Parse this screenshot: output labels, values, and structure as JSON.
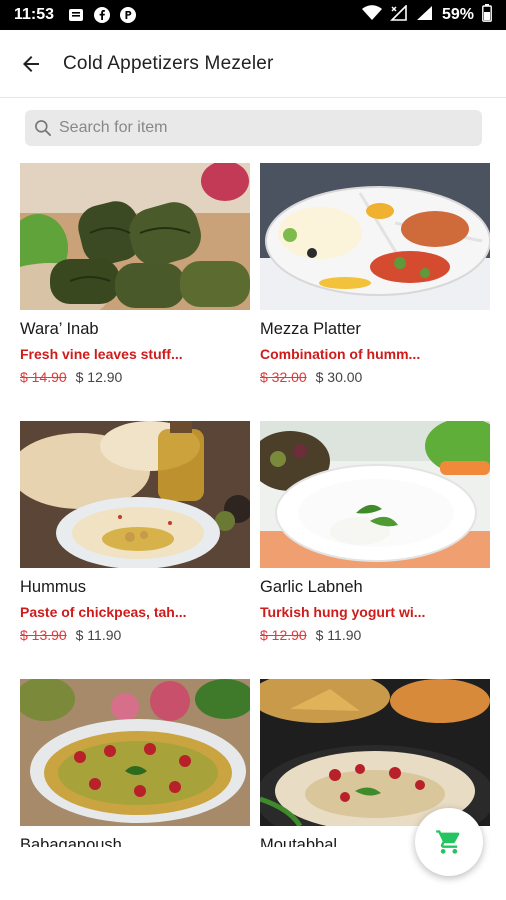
{
  "status_bar": {
    "time": "11:53",
    "battery": "59%"
  },
  "header": {
    "title": "Cold Appetizers Mezeler"
  },
  "search": {
    "placeholder": "Search for item"
  },
  "items": [
    {
      "name": "Wara’ Inab",
      "description": "Fresh vine leaves stuff...",
      "old_price": "$ 14.90",
      "price": "$ 12.90"
    },
    {
      "name": "Mezza Platter",
      "description": "Combination of humm...",
      "old_price": "$ 32.00",
      "price": "$ 30.00"
    },
    {
      "name": "Hummus",
      "description": "Paste of chickpeas, tah...",
      "old_price": "$ 13.90",
      "price": "$ 11.90"
    },
    {
      "name": "Garlic Labneh",
      "description": "Turkish hung yogurt wi...",
      "old_price": "$ 12.90",
      "price": "$ 11.90"
    },
    {
      "name": "Babaganoush",
      "description": "",
      "old_price": "",
      "price": ""
    },
    {
      "name": "Moutabbal",
      "description": "",
      "old_price": "",
      "price": ""
    }
  ],
  "colors": {
    "accent": "#d01b1b",
    "cart": "#22c55e"
  },
  "icons": {
    "back": "arrow-left-icon",
    "search": "search-icon",
    "cart": "cart-icon"
  }
}
